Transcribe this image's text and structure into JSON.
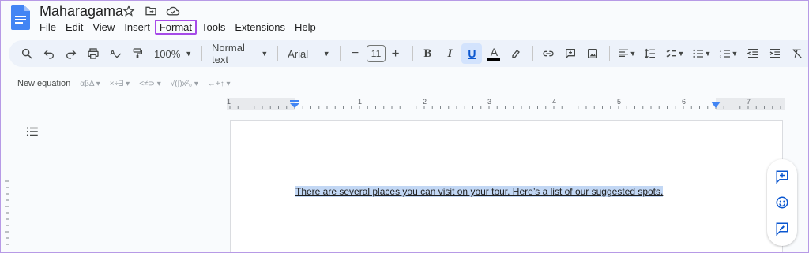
{
  "doc": {
    "title": "Maharagama"
  },
  "menu": [
    "File",
    "Edit",
    "View",
    "Insert",
    "Format",
    "Tools",
    "Extensions",
    "Help"
  ],
  "menu_highlighted": "Format",
  "toolbar": {
    "zoom": "100%",
    "style": "Normal text",
    "font": "Arial",
    "font_size": "11",
    "minus": "−",
    "plus": "+",
    "bold": "B",
    "italic": "I",
    "underline": "U",
    "text_color": "A"
  },
  "equation_bar": {
    "new_equation": "New equation",
    "groups": [
      "αβΔ ▾",
      "×÷∃ ▾",
      "<≠⊃ ▾",
      "√(∫)x²₀ ▾",
      "←+↑ ▾"
    ]
  },
  "ruler": {
    "labels": [
      "1",
      "1",
      "2",
      "3",
      "4",
      "5",
      "6",
      "7"
    ]
  },
  "page": {
    "text": "There are several places you can visit on your tour. Here’s a list of our suggested spots."
  },
  "colors": {
    "accent": "#0b57d0",
    "toolbar_bg": "#edf2fa",
    "highlight_box": "#a64be8",
    "selection": "#c2d7f4"
  }
}
